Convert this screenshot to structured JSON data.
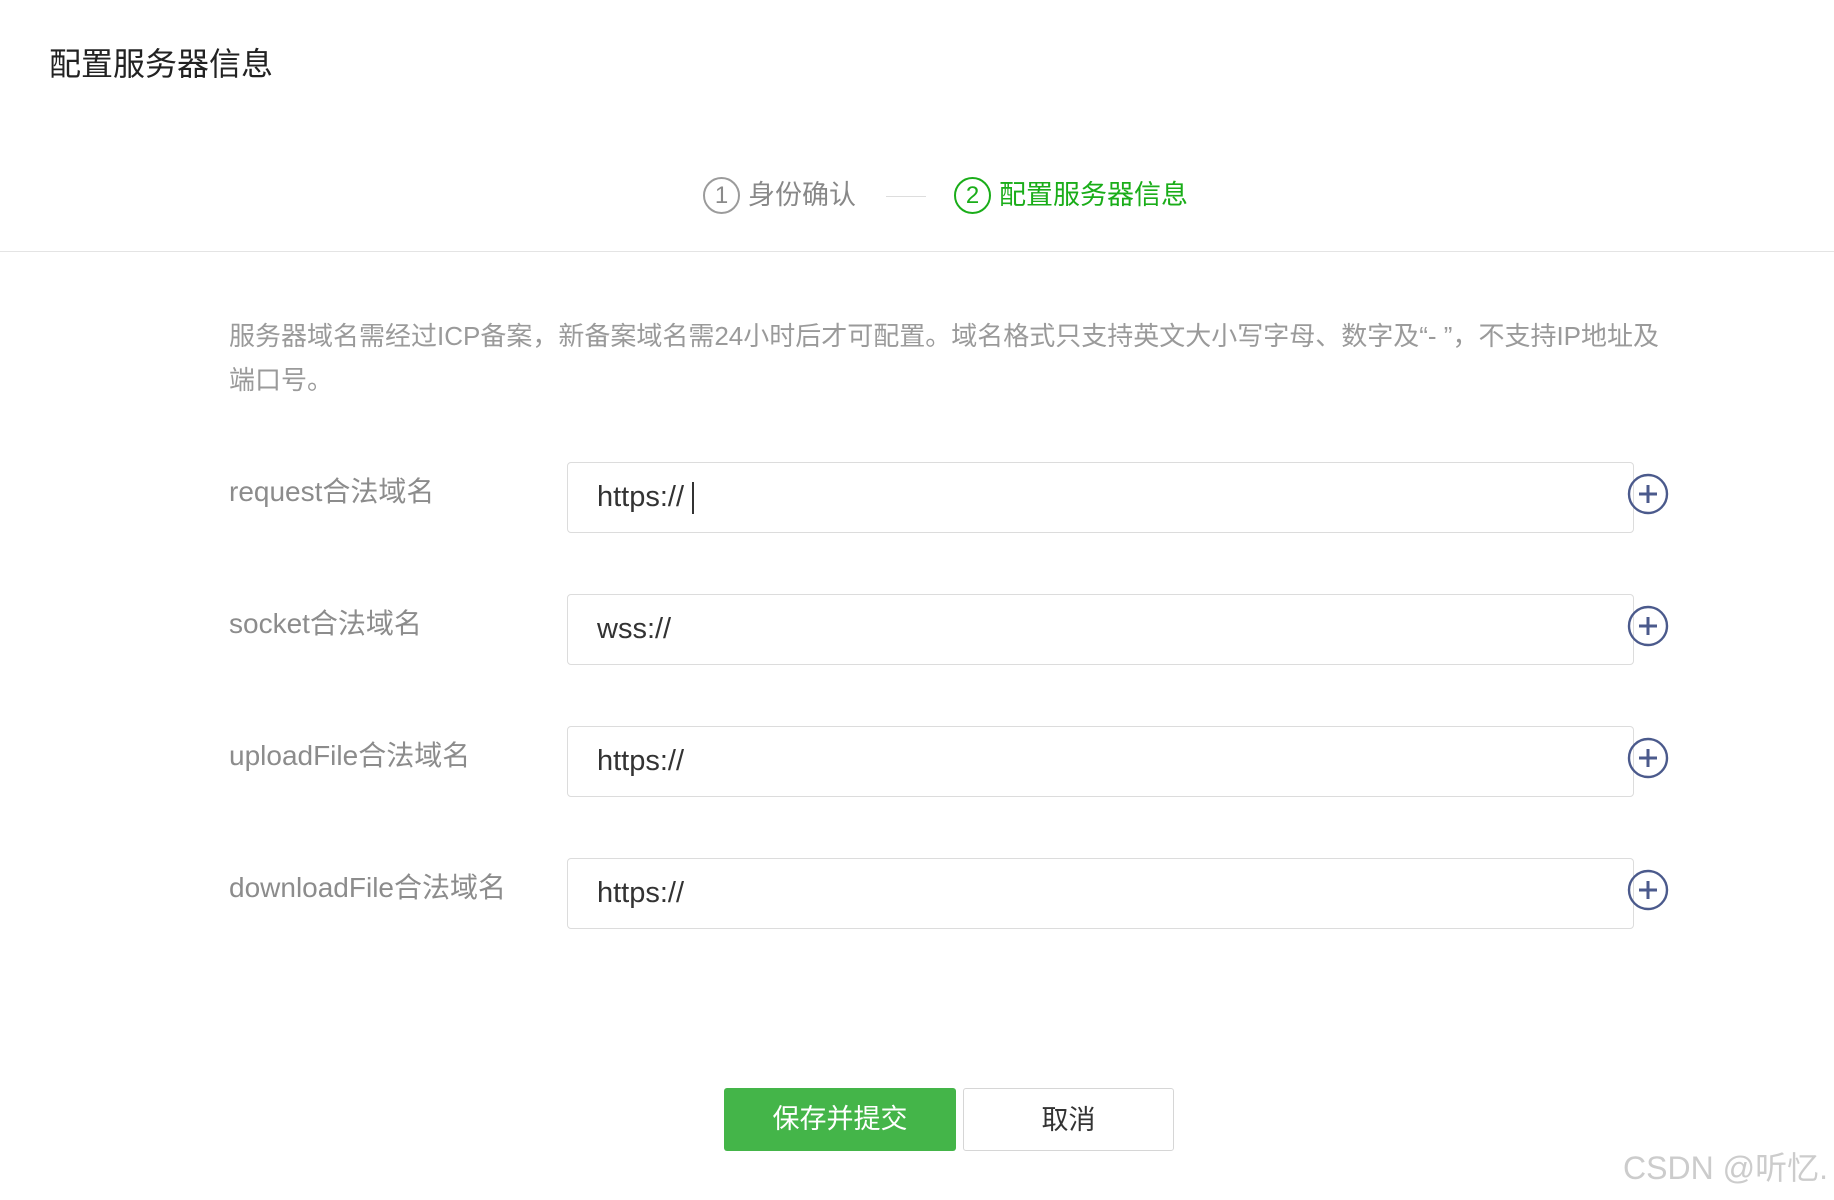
{
  "page_title": "配置服务器信息",
  "steps": [
    {
      "number": "1",
      "label": "身份确认"
    },
    {
      "number": "2",
      "label": "配置服务器信息"
    }
  ],
  "description": "服务器域名需经过ICP备案，新备案域名需24小时后才可配置。域名格式只支持英文大小写字母、数字及“- ”，不支持IP地址及端口号。",
  "fields": [
    {
      "label": "request合法域名",
      "value": "https://",
      "icon": "plus-circle-icon"
    },
    {
      "label": "socket合法域名",
      "value": "wss://",
      "icon": "plus-circle-icon"
    },
    {
      "label": "uploadFile合法域名",
      "value": "https://",
      "icon": "plus-circle-icon"
    },
    {
      "label": "downloadFile合法域名",
      "value": "https://",
      "icon": "plus-circle-icon"
    }
  ],
  "actions": {
    "submit_label": "保存并提交",
    "cancel_label": "取消"
  },
  "watermark": "CSDN @听忆.",
  "colors": {
    "active_step": "#1aad19",
    "primary_button": "#44b549",
    "add_icon": "#4b5a8c",
    "muted_text": "#9a9a9a"
  }
}
